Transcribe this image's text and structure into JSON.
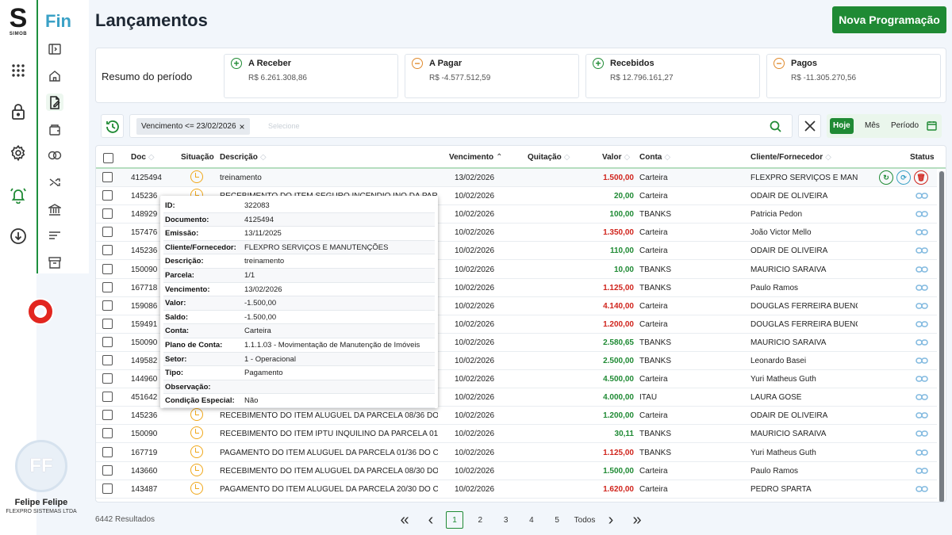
{
  "brand": {
    "logo_letter": "S",
    "logo_text": "SIMOB",
    "module": "Fin"
  },
  "user": {
    "initials": "FF",
    "name": "Felipe Felipe",
    "company": "FLEXPRO SISTEMAS LTDA"
  },
  "page": {
    "title": "Lançamentos",
    "new_button": "Nova Programação"
  },
  "summary": {
    "title": "Resumo do período",
    "cards": [
      {
        "label": "A Receber",
        "value": "R$ 6.261.308,86",
        "sign": "+",
        "color": "#1f8a34"
      },
      {
        "label": "A Pagar",
        "value": "R$ -4.577.512,59",
        "sign": "−",
        "color": "#e08a2c"
      },
      {
        "label": "Recebidos",
        "value": "R$ 12.796.161,27",
        "sign": "+",
        "color": "#1f8a34"
      },
      {
        "label": "Pagos",
        "value": "R$ -11.305.270,56",
        "sign": "−",
        "color": "#e08a2c"
      }
    ]
  },
  "filter": {
    "chip": "Vencimento <= 23/02/2026",
    "placeholder": "Selecione",
    "today": "Hoje",
    "month": "Mês",
    "period": "Período"
  },
  "columns": {
    "doc": "Doc",
    "situacao": "Situação",
    "descricao": "Descrição",
    "vencimento": "Vencimento",
    "quitacao": "Quitação",
    "valor": "Valor",
    "conta": "Conta",
    "cliente": "Cliente/Fornecedor",
    "status": "Status"
  },
  "rows": [
    {
      "doc": "4125494",
      "desc": "treinamento",
      "venc": "13/02/2026",
      "valor": "1.500,00",
      "neg": true,
      "conta": "Carteira",
      "cliente": "FLEXPRO SERVIÇOS E MAN..."
    },
    {
      "doc": "145236",
      "desc": "RECEBIMENTO DO ITEM SEGURO INCÊNDIO INQ DA PAR...",
      "venc": "10/02/2026",
      "valor": "20,00",
      "neg": false,
      "conta": "Carteira",
      "cliente": "ODAIR DE OLIVEIRA"
    },
    {
      "doc": "148929",
      "desc": "",
      "venc": "10/02/2026",
      "valor": "100,00",
      "neg": false,
      "conta": "TBANKS",
      "cliente": "Patricia Pedon"
    },
    {
      "doc": "157476",
      "desc": "",
      "venc": "10/02/2026",
      "valor": "1.350,00",
      "neg": true,
      "conta": "Carteira",
      "cliente": "João Victor Mello"
    },
    {
      "doc": "145236",
      "desc": "",
      "venc": "10/02/2026",
      "valor": "110,00",
      "neg": false,
      "conta": "Carteira",
      "cliente": "ODAIR DE OLIVEIRA"
    },
    {
      "doc": "150090",
      "desc": "",
      "venc": "10/02/2026",
      "valor": "10,00",
      "neg": false,
      "conta": "TBANKS",
      "cliente": "MAURICIO SARAIVA"
    },
    {
      "doc": "167718",
      "desc": "",
      "venc": "10/02/2026",
      "valor": "1.125,00",
      "neg": true,
      "conta": "TBANKS",
      "cliente": "Paulo Ramos"
    },
    {
      "doc": "159086",
      "desc": "",
      "venc": "10/02/2026",
      "valor": "4.140,00",
      "neg": true,
      "conta": "Carteira",
      "cliente": "DOUGLAS FERREIRA BUENO"
    },
    {
      "doc": "159491",
      "desc": "",
      "venc": "10/02/2026",
      "valor": "1.200,00",
      "neg": true,
      "conta": "Carteira",
      "cliente": "DOUGLAS FERREIRA BUENO"
    },
    {
      "doc": "150090",
      "desc": "",
      "venc": "10/02/2026",
      "valor": "2.580,65",
      "neg": false,
      "conta": "TBANKS",
      "cliente": "MAURICIO SARAIVA"
    },
    {
      "doc": "149582",
      "desc": "",
      "venc": "10/02/2026",
      "valor": "2.500,00",
      "neg": false,
      "conta": "TBANKS",
      "cliente": "Leonardo Basei"
    },
    {
      "doc": "144960",
      "desc": "",
      "venc": "10/02/2026",
      "valor": "4.500,00",
      "neg": false,
      "conta": "Carteira",
      "cliente": "Yuri Matheus Guth"
    },
    {
      "doc": "451642",
      "desc": "",
      "venc": "10/02/2026",
      "valor": "4.000,00",
      "neg": false,
      "conta": "ITAÚ",
      "cliente": "LAURA GOSE"
    },
    {
      "doc": "145236",
      "desc": "RECEBIMENTO DO ITEM ALUGUEL DA PARCELA 08/36 DO...",
      "venc": "10/02/2026",
      "valor": "1.200,00",
      "neg": false,
      "conta": "Carteira",
      "cliente": "ODAIR DE OLIVEIRA"
    },
    {
      "doc": "150090",
      "desc": "RECEBIMENTO DO ITEM IPTU INQUILINO DA PARCELA 01...",
      "venc": "10/02/2026",
      "valor": "30,11",
      "neg": false,
      "conta": "TBANKS",
      "cliente": "MAURICIO SARAIVA"
    },
    {
      "doc": "167719",
      "desc": "PAGAMENTO DO ITEM ALUGUEL DA PARCELA 01/36 DO C...",
      "venc": "10/02/2026",
      "valor": "1.125,00",
      "neg": true,
      "conta": "TBANKS",
      "cliente": "Yuri Matheus Guth"
    },
    {
      "doc": "143660",
      "desc": "RECEBIMENTO DO ITEM ALUGUEL DA PARCELA 08/30 DO...",
      "venc": "10/02/2026",
      "valor": "1.500,00",
      "neg": false,
      "conta": "Carteira",
      "cliente": "Paulo Ramos"
    },
    {
      "doc": "143487",
      "desc": "PAGAMENTO DO ITEM ALUGUEL DA PARCELA 20/30 DO C...",
      "venc": "10/02/2026",
      "valor": "1.620,00",
      "neg": true,
      "conta": "Carteira",
      "cliente": "PEDRO SPARTA"
    }
  ],
  "tooltip": [
    {
      "k": "ID:",
      "v": "322083"
    },
    {
      "k": "Documento:",
      "v": "4125494"
    },
    {
      "k": "Emissão:",
      "v": "13/11/2025"
    },
    {
      "k": "Cliente/Fornecedor:",
      "v": "FLEXPRO SERVIÇOS E MANUTENÇÕES"
    },
    {
      "k": "Descrição:",
      "v": "treinamento"
    },
    {
      "k": "Parcela:",
      "v": "1/1"
    },
    {
      "k": "Vencimento:",
      "v": "13/02/2026"
    },
    {
      "k": "Valor:",
      "v": "-1.500,00"
    },
    {
      "k": "Saldo:",
      "v": "-1.500,00"
    },
    {
      "k": "Conta:",
      "v": "Carteira"
    },
    {
      "k": "Plano de Conta:",
      "v": "1.1.1.03 - Movimentação de Manutenção de Imóveis"
    },
    {
      "k": "Setor:",
      "v": "1 - Operacional"
    },
    {
      "k": "Tipo:",
      "v": "Pagamento"
    },
    {
      "k": "Observação:",
      "v": ""
    },
    {
      "k": "Condição Especial:",
      "v": "Não"
    }
  ],
  "pagination": {
    "results": "6442 Resultados",
    "pages": [
      "1",
      "2",
      "3",
      "4",
      "5"
    ],
    "all": "Todos",
    "current": "1"
  }
}
